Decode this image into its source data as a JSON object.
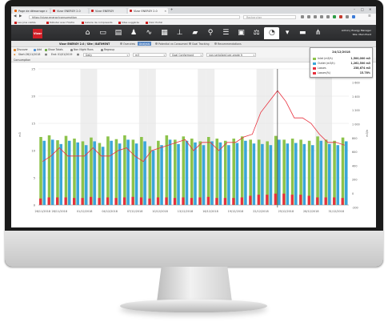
{
  "browser": {
    "tabs": [
      {
        "label": "Page de démarrage de Firefox"
      },
      {
        "label": "Vizor ENERGY 2.0"
      },
      {
        "label": "Vizor ENERGY"
      },
      {
        "label": "Vizor ENERGY 2.0"
      }
    ],
    "url": "https://vizor.energy/consumption",
    "search_placeholder": "Rechercher",
    "bookmarks": [
      {
        "label": "Les plus visités"
      },
      {
        "label": "Débuter avec Firefox"
      },
      {
        "label": "Galerie de composants"
      },
      {
        "label": "Sites suggérés"
      },
      {
        "label": "Vizor Portal"
      }
    ]
  },
  "app": {
    "logo": "Vizor",
    "modules": [
      {
        "icon": "home-icon",
        "glyph": "⌂"
      },
      {
        "icon": "monitor-icon",
        "glyph": "▭"
      },
      {
        "icon": "factory-icon",
        "glyph": "▤"
      },
      {
        "icon": "bell-icon",
        "glyph": "♟"
      },
      {
        "icon": "pulse-icon",
        "glyph": "∿"
      },
      {
        "icon": "grid-icon",
        "glyph": "▦"
      },
      {
        "icon": "network-icon",
        "glyph": "⊥"
      },
      {
        "icon": "truck-icon",
        "glyph": "▰"
      },
      {
        "icon": "pin-icon",
        "glyph": "⚲"
      },
      {
        "icon": "list-icon",
        "glyph": "☰"
      },
      {
        "icon": "doc-icon",
        "glyph": "▣"
      },
      {
        "icon": "balance-icon",
        "glyph": "⚖"
      },
      {
        "icon": "gauge-icon",
        "glyph": "◔"
      },
      {
        "icon": "filter-icon",
        "glyph": "▾"
      },
      {
        "icon": "chat-icon",
        "glyph": "▬"
      },
      {
        "icon": "share-icon",
        "glyph": "⋔"
      }
    ],
    "selected_module_index": 12,
    "user_line1": "Admin | Energy Manager",
    "user_line2": "Site: Main Plant",
    "subtabs": [
      {
        "label": "Vizor ENERGY 2.0 / Site / BATIMENT"
      },
      {
        "label": "Overview"
      },
      {
        "label": "Analysis"
      },
      {
        "label": "Potential vs Consumed"
      },
      {
        "label": "Goal Tracking"
      },
      {
        "label": "Recommendations"
      }
    ],
    "selected_subtab_index": 2
  },
  "toolbar": {
    "buttons": [
      {
        "label": "Discover"
      },
      {
        "label": "Add"
      },
      {
        "label": "Show Totals"
      },
      {
        "label": "Non Night Runs"
      },
      {
        "label": "Regroup"
      }
    ],
    "start_label": "Start:",
    "start_value": "26/11/2018",
    "end_label": "End:",
    "end_value": "01/01/2019",
    "granularity": "Daily",
    "unit": "m3",
    "mode": "Goal Conformant",
    "meter": "non-serialized per-grade fr"
  },
  "chart_data": {
    "type": "bar",
    "chart_label": "Consumption",
    "categories": [
      "26/11",
      "27/11",
      "28/11",
      "29/11",
      "30/11",
      "01/12",
      "02/12",
      "03/12",
      "04/12",
      "05/12",
      "06/12",
      "07/12",
      "08/12",
      "09/12",
      "10/12",
      "11/12",
      "12/12",
      "13/12",
      "14/12",
      "15/12",
      "16/12",
      "17/12",
      "18/12",
      "19/12",
      "20/12",
      "21/12",
      "22/12",
      "23/12",
      "24/12",
      "25/12",
      "26/12",
      "27/12",
      "28/12",
      "29/12",
      "30/12",
      "31/12",
      "01/01"
    ],
    "x_tick_labels": [
      "26/11/2018",
      "28/11/2018",
      "01/12/2018",
      "04/12/2018",
      "07/12/2018",
      "10/12/2018",
      "13/12/2018",
      "16/12/2018",
      "19/12/2018",
      "22/12/2018",
      "25/12/2018",
      "28/12/2018",
      "31/12/2018"
    ],
    "x_tick_indices": [
      0,
      2,
      5,
      8,
      11,
      14,
      17,
      20,
      23,
      26,
      29,
      32,
      35
    ],
    "series": [
      {
        "name": "Inlet (m3/h)",
        "color": "#8cc34b",
        "values": [
          125,
          128,
          119,
          127,
          122,
          117,
          124,
          114,
          126,
          121,
          128,
          120,
          125,
          108,
          118,
          128,
          120,
          126,
          122,
          117,
          125,
          122,
          118,
          122,
          126,
          120,
          120,
          117,
          127,
          120,
          122,
          120,
          118,
          126,
          120,
          118,
          124
        ]
      },
      {
        "name": "Outlet (m3/h)",
        "color": "#3aa6d9",
        "values": [
          118,
          120,
          112,
          118,
          115,
          110,
          117,
          107,
          118,
          113,
          120,
          113,
          117,
          100,
          110,
          120,
          112,
          118,
          115,
          110,
          117,
          115,
          110,
          114,
          118,
          113,
          112,
          110,
          120,
          113,
          114,
          112,
          110,
          118,
          112,
          110,
          117
        ]
      },
      {
        "name": "Losses",
        "color": "#e8303d",
        "values": [
          12,
          14,
          14,
          14,
          13,
          13,
          15,
          13,
          14,
          13,
          14,
          15,
          14,
          12,
          14,
          14,
          13,
          14,
          13,
          14,
          15,
          13,
          13,
          13,
          14,
          17,
          19,
          19,
          21,
          21,
          19,
          19,
          17,
          14,
          14,
          14,
          13
        ]
      },
      {
        "name": "Losses(%)",
        "color": "#e8303d",
        "values": [
          8,
          9,
          10.5,
          9,
          9,
          9,
          10.5,
          9,
          9,
          10,
          10.5,
          9,
          8,
          10,
          10.5,
          11,
          11.5,
          12,
          10,
          11.5,
          11.5,
          10,
          11.5,
          11.5,
          12.5,
          13,
          17,
          19,
          21,
          19,
          16,
          16,
          15,
          13,
          11.5,
          11.5,
          11
        ]
      }
    ],
    "y_left": {
      "ticks": [
        "0",
        "5",
        "10",
        "15",
        "20",
        "25"
      ],
      "ylim": [
        0,
        250
      ],
      "label": "m3"
    },
    "y_right": {
      "ticks": [
        "-200",
        "0",
        "200",
        "400",
        "600",
        "800",
        "1 000",
        "1 200",
        "1 400",
        "1 600",
        "1 800"
      ],
      "ylim": [
        -200,
        1800
      ],
      "label": "m3/h"
    },
    "tooltip": {
      "title": "24/12/2018",
      "rows": [
        {
          "label": "Inlet (m3/h)",
          "value": "1,500,000 m3",
          "color": "#8cc34b"
        },
        {
          "label": "Outlet (m3/h)",
          "value": "1,262,500 m3",
          "color": "#3aa6d9"
        },
        {
          "label": "Losses",
          "value": "238,674 m3",
          "color": "#e8303d"
        },
        {
          "label": "Losses(%)",
          "value": "15.78%",
          "color": "#e8303d"
        }
      ]
    },
    "cursor_index": 28,
    "shaded_weekend_indices": [
      5,
      6,
      12,
      13,
      19,
      20,
      26,
      27,
      33,
      34
    ]
  }
}
